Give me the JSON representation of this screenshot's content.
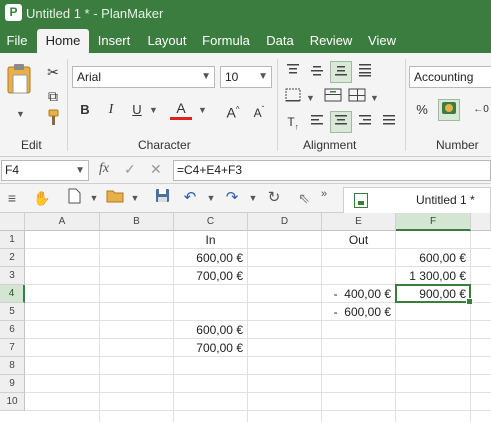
{
  "window": {
    "app_icon_letter": "P",
    "title": "Untitled 1 * - PlanMaker"
  },
  "tabs": [
    {
      "label": "File"
    },
    {
      "label": "Home"
    },
    {
      "label": "Insert"
    },
    {
      "label": "Layout"
    },
    {
      "label": "Formula"
    },
    {
      "label": "Data"
    },
    {
      "label": "Review"
    },
    {
      "label": "View"
    }
  ],
  "ribbon": {
    "groups": {
      "edit": "Edit",
      "character": "Character",
      "alignment": "Alignment",
      "number": "Number"
    },
    "font_name": "Arial",
    "font_size": "10",
    "number_format": "Accounting",
    "bold": "B",
    "italic": "I",
    "underline": "U",
    "font_color_letter": "A",
    "percent": "%",
    "decimal": "←0"
  },
  "formula_bar": {
    "name_box": "F4",
    "fx": "fx",
    "cancel": "✓",
    "accept": "✕",
    "formula": "=C4+E4+F3"
  },
  "doc_tab": {
    "title": "Untitled 1 *"
  },
  "sheet": {
    "columns": [
      "A",
      "B",
      "C",
      "D",
      "E",
      "F"
    ],
    "rows": [
      "1",
      "2",
      "3",
      "4",
      "5",
      "6",
      "7",
      "8",
      "9",
      "10"
    ],
    "active_cell": "F4",
    "cells": {
      "C1": "In",
      "E1": "Out",
      "C2": "600,00 €",
      "F2": "600,00 €",
      "C3": "700,00 €",
      "F3": "1 300,00 €",
      "E4": "-  400,00 €",
      "F4": "900,00 €",
      "E5": "-  600,00 €",
      "C6": "600,00 €",
      "C7": "700,00 €"
    }
  },
  "colors": {
    "brand_green": "#3b7d3f",
    "ribbon_bg": "#f4f4f4",
    "font_color_underline": "#e0201e"
  }
}
